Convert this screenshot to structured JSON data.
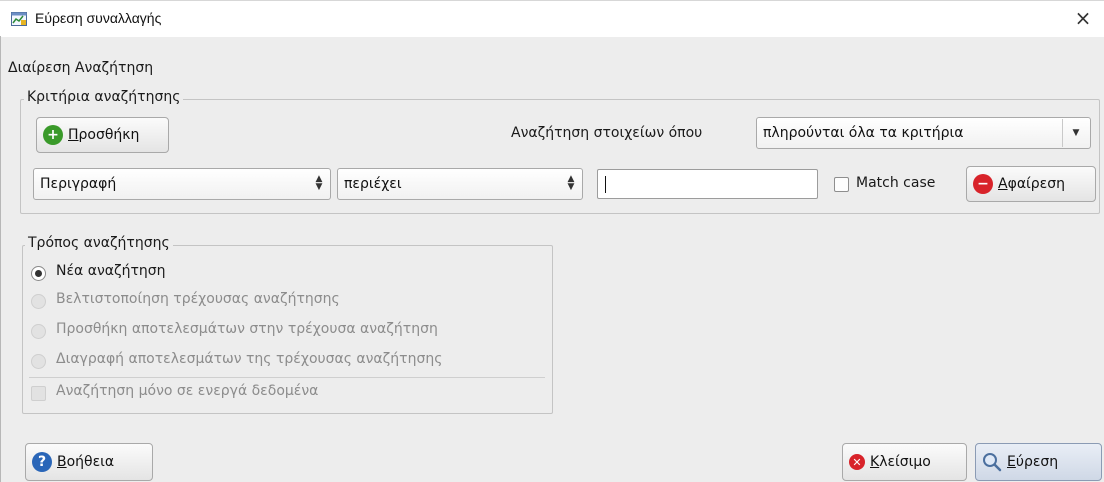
{
  "window": {
    "title": "Εύρεση συναλλαγής",
    "close_glyph": "×",
    "app_icon": "app-window-icon"
  },
  "section_label": "Διαίρεση Αναζήτηση",
  "criteria": {
    "group_title": "Κριτήρια αναζήτησης",
    "add_button": {
      "mnemonic": "Π",
      "rest": "ροσθήκη",
      "icon": "plus-circle-icon"
    },
    "match_label": "Αναζήτηση στοιχείων όπου",
    "match_select_value": "πληρούνται όλα τα κριτήρια",
    "row": {
      "field_value": "Περιγραφή",
      "operator_value": "περιέχει",
      "text_value": "",
      "match_case_label": "Match case",
      "match_case_checked": false,
      "remove_button": {
        "mnemonic": "Α",
        "rest": "φαίρεση",
        "icon": "minus-circle-icon"
      }
    }
  },
  "mode": {
    "group_title": "Τρόπος αναζήτησης",
    "options": [
      {
        "label": "Νέα αναζήτηση",
        "checked": true,
        "enabled": true
      },
      {
        "label": "Βελτιστοποίηση τρέχουσας αναζήτησης",
        "checked": false,
        "enabled": false
      },
      {
        "label": "Προσθήκη αποτελεσμάτων στην τρέχουσα αναζήτηση",
        "checked": false,
        "enabled": false
      },
      {
        "label": "Διαγραφή αποτελεσμάτων της τρέχουσας αναζήτησης",
        "checked": false,
        "enabled": false
      }
    ],
    "active_only_label": "Αναζήτηση μόνο σε ενεργά δεδομένα"
  },
  "footer": {
    "help_button": {
      "mnemonic": "Β",
      "rest": "οήθεια",
      "icon": "help-icon"
    },
    "close_button": {
      "mnemonic": "Κ",
      "rest": "λείσιμο",
      "icon": "close-circle-icon"
    },
    "find_button": {
      "mnemonic": "Ε",
      "rest": "ύρεση",
      "icon": "search-icon"
    }
  },
  "colors": {
    "add_icon": "#3a9a2a",
    "remove_icon": "#d8232a",
    "help_icon": "#2a66b8",
    "close_icon": "#d8232a"
  }
}
